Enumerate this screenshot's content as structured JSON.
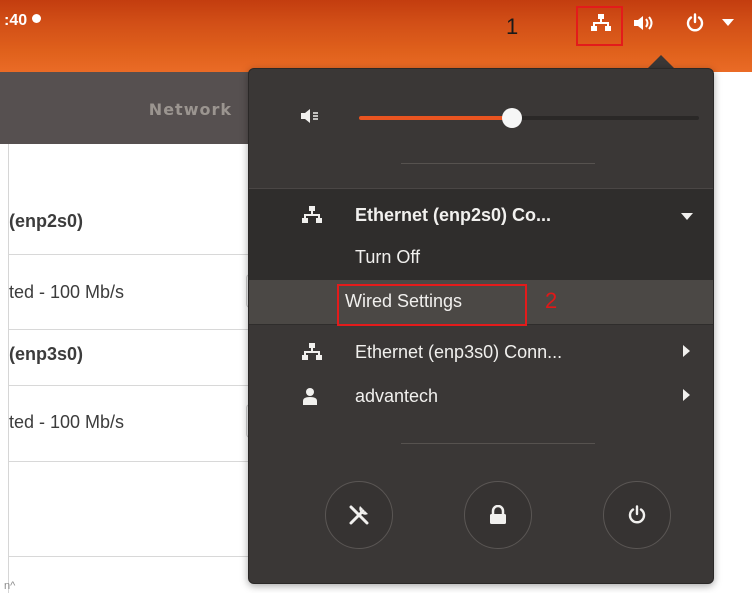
{
  "topbar": {
    "clock_partial": ":40",
    "annotation_1": "1"
  },
  "network_window": {
    "title": "Network",
    "rows": [
      {
        "text": "(enp2s0)",
        "bold": true
      },
      {
        "text": "ted - 100 Mb/s",
        "bold": false
      },
      {
        "text": "(enp3s0)",
        "bold": true
      },
      {
        "text": "ted - 100 Mb/s",
        "bold": false
      }
    ],
    "footer_partial": "n^"
  },
  "popup": {
    "volume_level": 0.45,
    "ethernet1": {
      "label": "Ethernet (enp2s0) Co..."
    },
    "turn_off": "Turn Off",
    "wired_settings": "Wired Settings",
    "annotation_2": "2",
    "ethernet2": {
      "label": "Ethernet (enp3s0) Conn..."
    },
    "user": {
      "label": "advantech"
    }
  },
  "colors": {
    "accent": "#e95420",
    "popup_bg": "#3a3736",
    "annotation_red": "#e31b1b"
  },
  "icons": [
    "network-icon",
    "volume-icon",
    "power-icon",
    "caret-down-icon",
    "volume-muted-icon",
    "user-icon",
    "chevron-right-icon",
    "settings-icon",
    "lock-icon"
  ]
}
